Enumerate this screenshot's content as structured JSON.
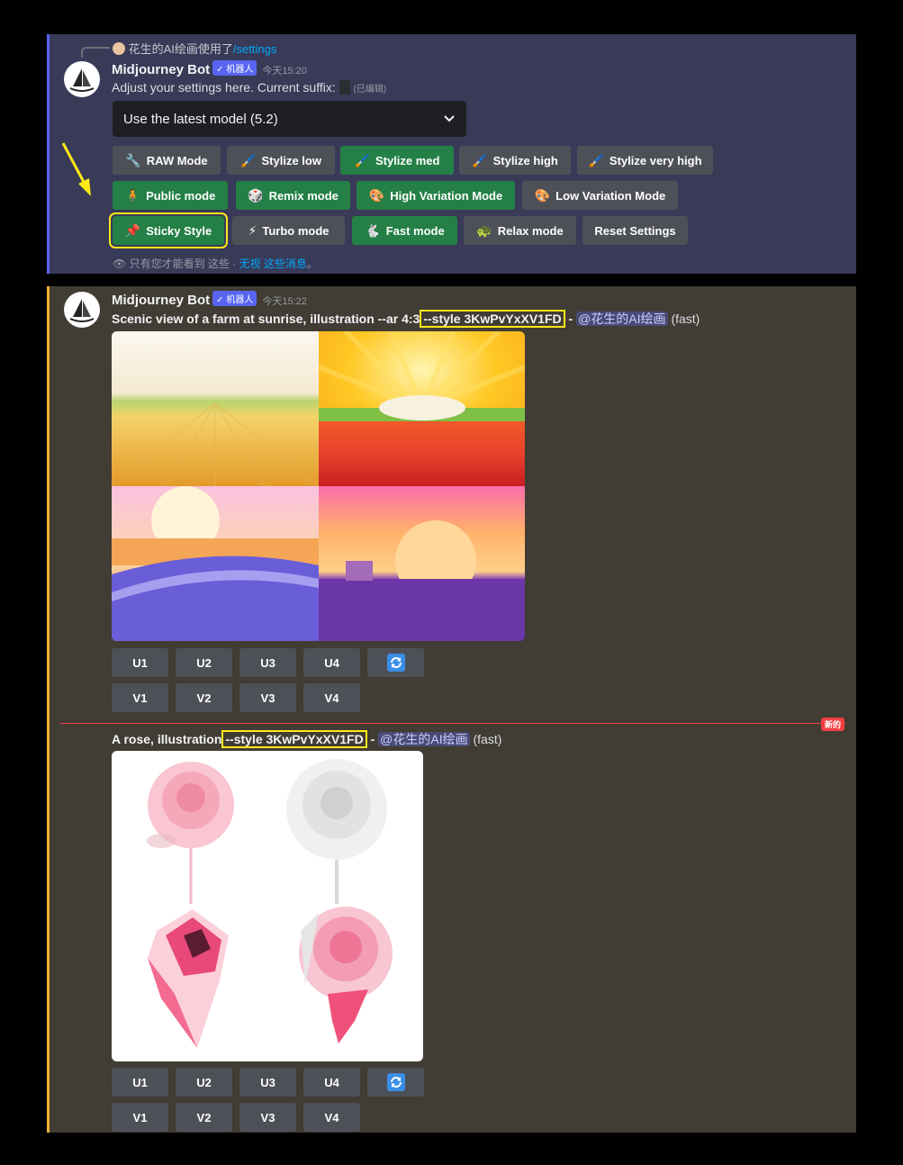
{
  "settings_message": {
    "reply_user": "花生的AI绘画使用了",
    "reply_command": "/settings",
    "username": "Midjourney Bot",
    "bot_tag": "✓ 机器人",
    "timestamp": "今天15:20",
    "content": "Adjust your settings here. Current suffix:",
    "edited": "(已编辑)",
    "select_value": "Use the latest model (5.2)",
    "rows": [
      [
        {
          "label": "RAW Mode",
          "icon": "wrench-icon",
          "style": "gray"
        },
        {
          "label": "Stylize low",
          "icon": "brush-icon",
          "style": "gray"
        },
        {
          "label": "Stylize med",
          "icon": "brush-icon",
          "style": "green"
        },
        {
          "label": "Stylize high",
          "icon": "brush-icon",
          "style": "gray"
        },
        {
          "label": "Stylize very high",
          "icon": "brush-icon",
          "style": "gray"
        }
      ],
      [
        {
          "label": "Public mode",
          "icon": "person-icon",
          "style": "green"
        },
        {
          "label": "Remix mode",
          "icon": "dice-icon",
          "style": "green"
        },
        {
          "label": "High Variation Mode",
          "icon": "palette-icon",
          "style": "green"
        },
        {
          "label": "Low Variation Mode",
          "icon": "palette-icon",
          "style": "gray"
        }
      ],
      [
        {
          "label": "Sticky Style",
          "icon": "pushpin-icon",
          "style": "green"
        },
        {
          "label": "Turbo mode",
          "icon": "lightning-icon",
          "style": "gray"
        },
        {
          "label": "Fast mode",
          "icon": "rabbit-icon",
          "style": "green"
        },
        {
          "label": "Relax mode",
          "icon": "turtle-icon",
          "style": "gray"
        },
        {
          "label": "Reset Settings",
          "icon": "",
          "style": "gray"
        }
      ]
    ],
    "ephemeral_note": "只有您才能看到 这些 · ",
    "dismiss_link": "无视 这些消息",
    "ephemeral_end": "。"
  },
  "farm_message": {
    "username": "Midjourney Bot",
    "bot_tag": "✓ 机器人",
    "timestamp": "今天15:22",
    "prompt_start": "Scenic view of a farm at sunrise, illustration --ar 4:3",
    "style_param": "--style 3KwPvYxXV1FD",
    "dash": " - ",
    "mention": "@花生的AI绘画",
    "mode": "(fast)",
    "upscale_labels": [
      "U1",
      "U2",
      "U3",
      "U4"
    ],
    "variation_labels": [
      "V1",
      "V2",
      "V3",
      "V4"
    ],
    "reroll_icon": "refresh-icon"
  },
  "new_divider": "新的",
  "rose_message": {
    "prompt_start": "A rose, illustration",
    "style_param": "--style 3KwPvYxXV1FD",
    "dash": " - ",
    "mention": "@花生的AI绘画",
    "mode": "(fast)",
    "upscale_labels": [
      "U1",
      "U2",
      "U3",
      "U4"
    ],
    "variation_labels": [
      "V1",
      "V2",
      "V3",
      "V4"
    ],
    "reroll_icon": "refresh-icon"
  }
}
